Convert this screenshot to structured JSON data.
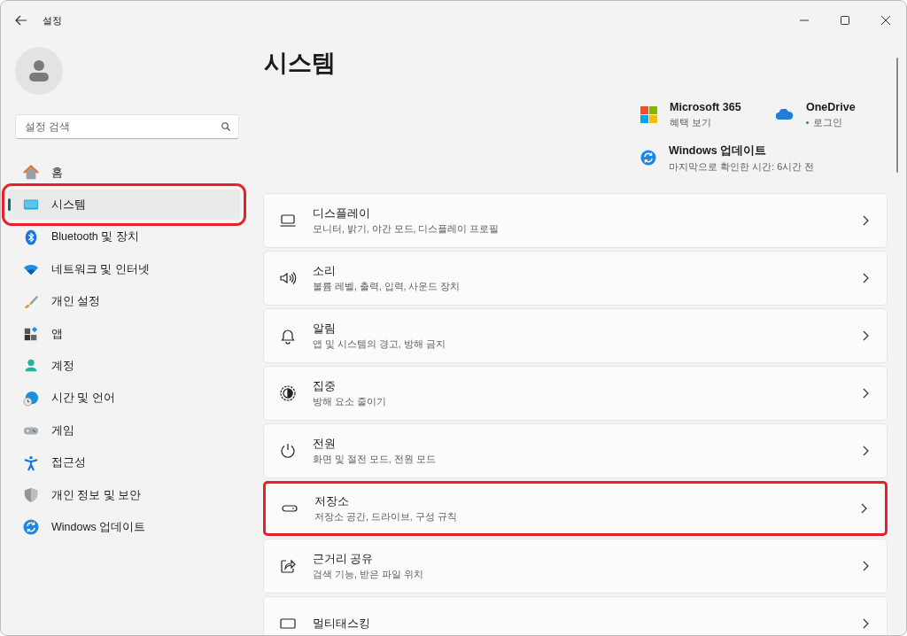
{
  "window": {
    "title": "설정"
  },
  "account": {
    "kind": "avatar"
  },
  "search": {
    "placeholder": "설정 검색"
  },
  "sidebar": {
    "items": [
      {
        "label": "홈",
        "selected": false,
        "highlighted": false
      },
      {
        "label": "시스템",
        "selected": true,
        "highlighted": true
      },
      {
        "label": "Bluetooth 및 장치",
        "selected": false,
        "highlighted": false
      },
      {
        "label": "네트워크 및 인터넷",
        "selected": false,
        "highlighted": false
      },
      {
        "label": "개인 설정",
        "selected": false,
        "highlighted": false
      },
      {
        "label": "앱",
        "selected": false,
        "highlighted": false
      },
      {
        "label": "계정",
        "selected": false,
        "highlighted": false
      },
      {
        "label": "시간 및 언어",
        "selected": false,
        "highlighted": false
      },
      {
        "label": "게임",
        "selected": false,
        "highlighted": false
      },
      {
        "label": "접근성",
        "selected": false,
        "highlighted": false
      },
      {
        "label": "개인 정보 및 보안",
        "selected": false,
        "highlighted": false
      },
      {
        "label": "Windows 업데이트",
        "selected": false,
        "highlighted": false
      }
    ]
  },
  "page_title": "시스템",
  "tiles": [
    {
      "title": "Microsoft 365",
      "subtitle": "혜택 보기"
    },
    {
      "title": "OneDrive",
      "subtitle": "로그인",
      "status_dot": true
    },
    {
      "title": "Windows 업데이트",
      "subtitle": "마지막으로 확인한 시간: 6시간 전"
    }
  ],
  "cards": [
    {
      "title": "디스플레이",
      "subtitle": "모니터, 밝기, 야간 모드, 디스플레이 프로필",
      "highlighted": false
    },
    {
      "title": "소리",
      "subtitle": "볼륨 레벨, 출력, 입력, 사운드 장치",
      "highlighted": false
    },
    {
      "title": "알림",
      "subtitle": "앱 및 시스템의 경고, 방해 금지",
      "highlighted": false
    },
    {
      "title": "집중",
      "subtitle": "방해 요소 줄이기",
      "highlighted": false
    },
    {
      "title": "전원",
      "subtitle": "화면 및 절전 모드, 전원 모드",
      "highlighted": false
    },
    {
      "title": "저장소",
      "subtitle": "저장소 공간, 드라이브, 구성 규칙",
      "highlighted": true
    },
    {
      "title": "근거리 공유",
      "subtitle": "검색 기능, 받은 파일 위치",
      "highlighted": false
    },
    {
      "title": "멀티태스킹",
      "highlighted": false
    }
  ]
}
